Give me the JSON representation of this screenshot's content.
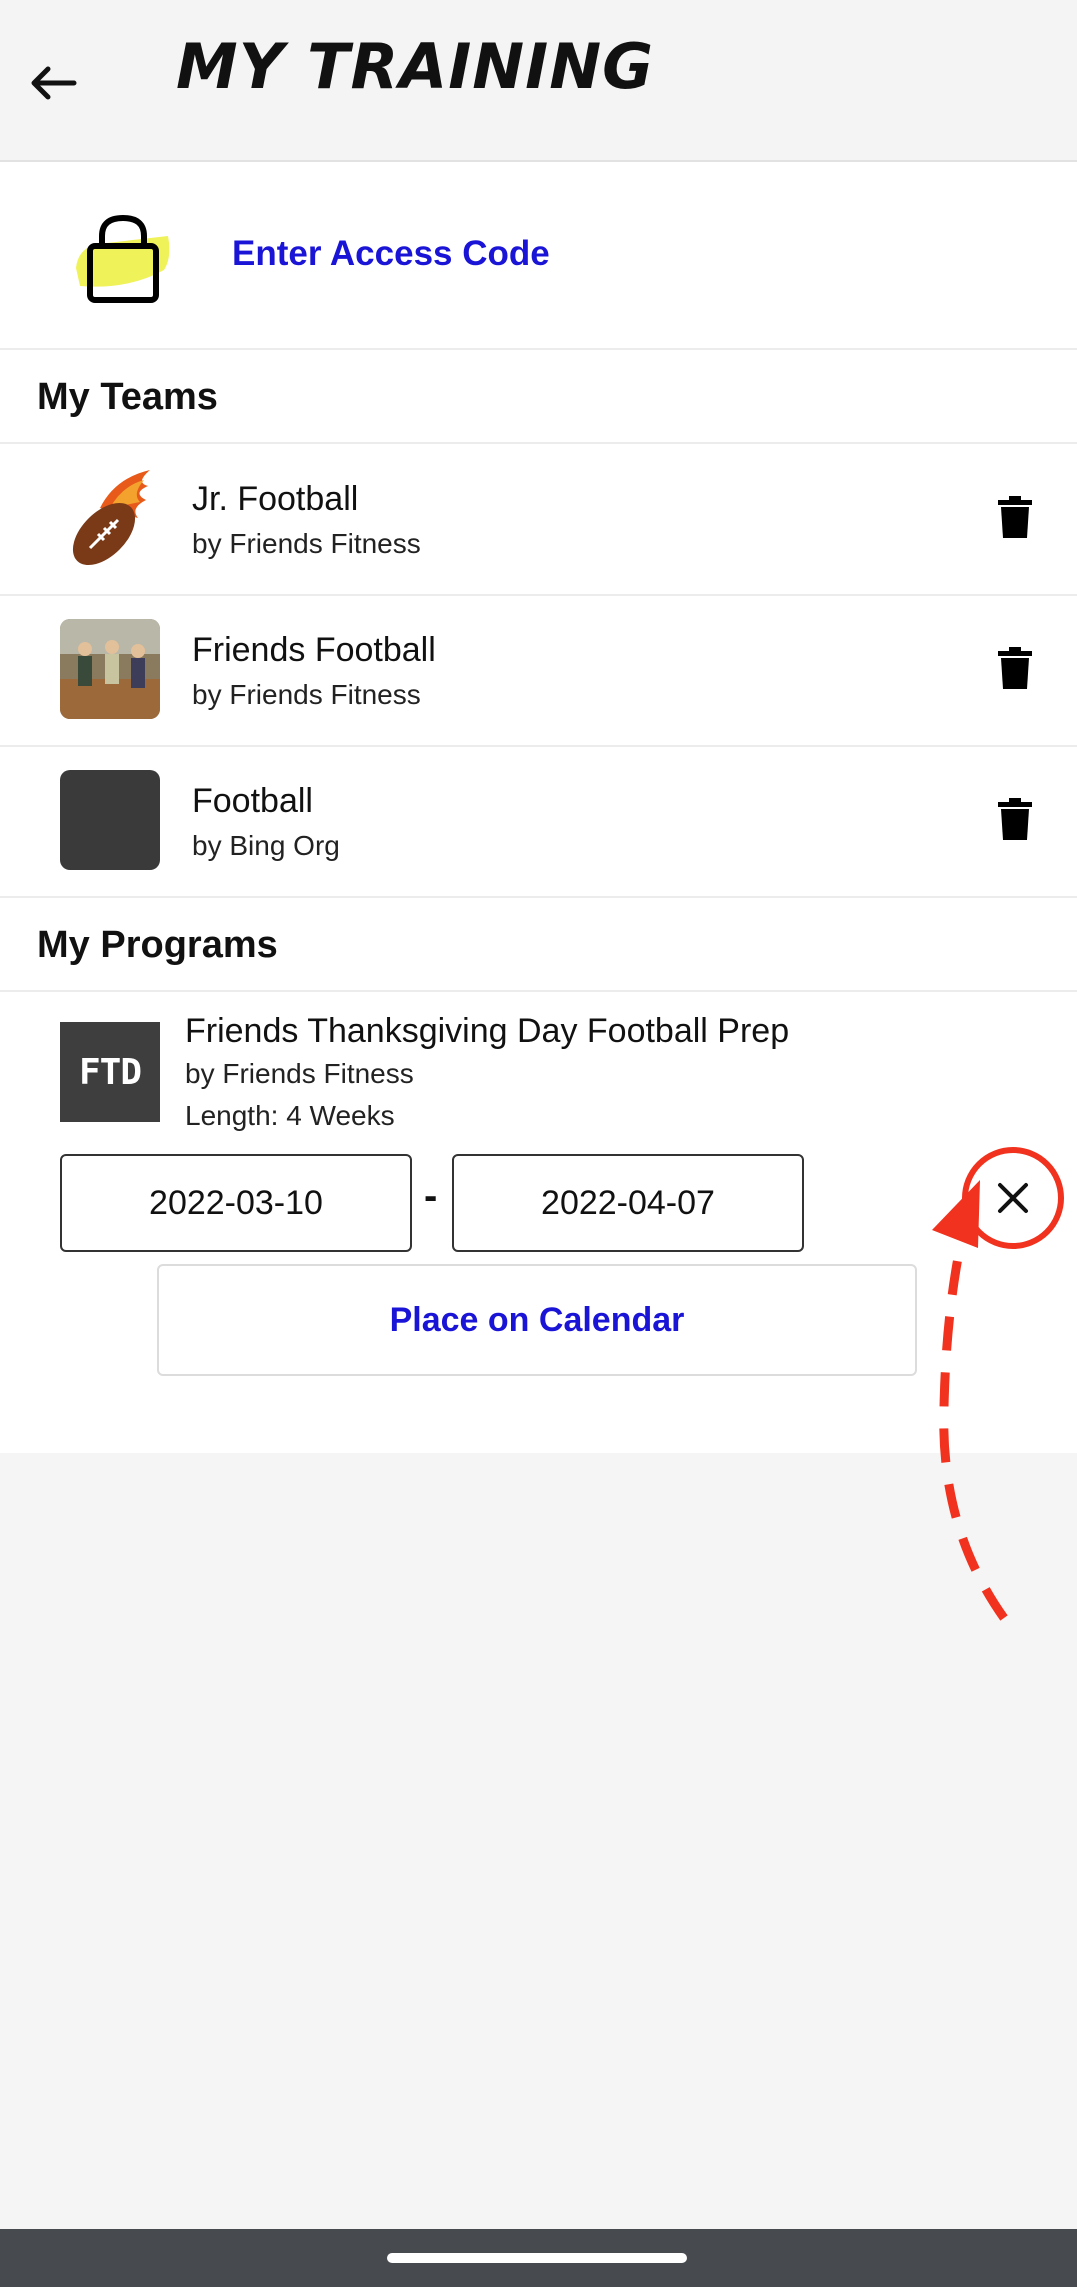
{
  "header": {
    "title": "MY TRAINING",
    "back_icon": "arrow-left-icon"
  },
  "access": {
    "label": "Enter Access Code",
    "icon": "lock-icon",
    "icon_accent": "#f0f25a"
  },
  "teams": {
    "section_title": "My Teams",
    "items": [
      {
        "name": "Jr. Football",
        "org": "by Friends Fitness",
        "thumb": "flaming-football-image"
      },
      {
        "name": "Friends Football",
        "org": "by Friends Fitness",
        "thumb": "team-photo-image"
      },
      {
        "name": "Football",
        "org": "by Bing Org",
        "thumb": "placeholder-dark-image"
      }
    ]
  },
  "programs": {
    "section_title": "My Programs",
    "items": [
      {
        "thumb_text": "FTD",
        "title": "Friends Thanksgiving Day Football Prep",
        "org": "by Friends Fitness",
        "length": "Length: 4 Weeks",
        "start_date": "2022-03-10",
        "separator": "-",
        "end_date": "2022-04-07",
        "place_button": "Place on Calendar"
      }
    ]
  },
  "colors": {
    "link_blue": "#1a14d6",
    "annotation_red": "#f0321e",
    "nav_bar": "#474b4f"
  }
}
